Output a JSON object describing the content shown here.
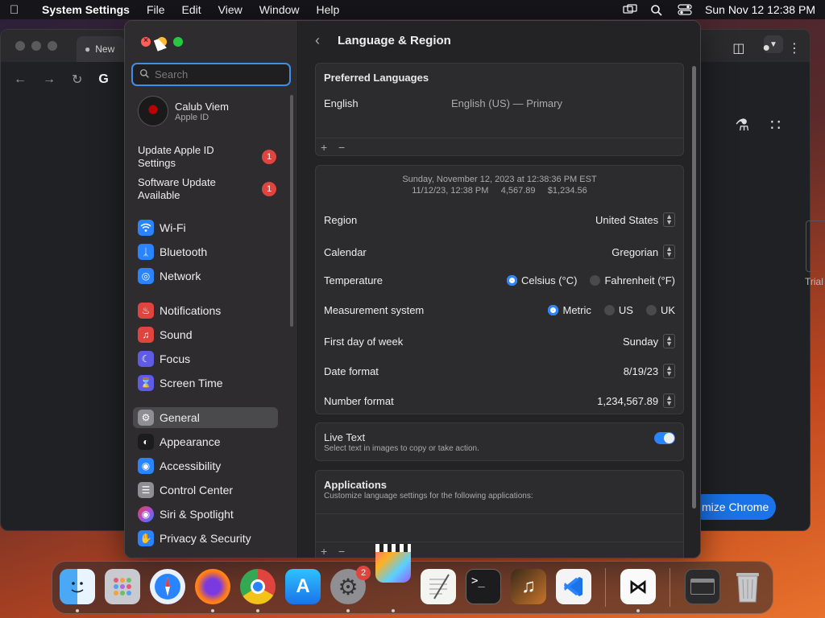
{
  "menubar": {
    "app_name": "System Settings",
    "menus": [
      "File",
      "Edit",
      "View",
      "Window",
      "Help"
    ],
    "datetime": "Sun Nov 12  12:38 PM"
  },
  "chrome": {
    "tab_label": "New",
    "customize_label": "mize Chrome",
    "trial_text": "Trial"
  },
  "sidebar": {
    "search_placeholder": "Search",
    "profile": {
      "name": "Calub Viem",
      "sub": "Apple ID"
    },
    "notices": [
      {
        "label": "Update Apple ID Settings",
        "badge": "1"
      },
      {
        "label": "Software Update Available",
        "badge": "1"
      }
    ],
    "items": [
      {
        "label": "Wi-Fi",
        "icon": "wifi-icon",
        "color": "#2a84ff"
      },
      {
        "label": "Bluetooth",
        "icon": "bluetooth-icon",
        "color": "#2a84ff"
      },
      {
        "label": "Network",
        "icon": "globe-icon",
        "color": "#2a84ff"
      },
      {
        "label": "Notifications",
        "icon": "bell-icon",
        "color": "#e0443e"
      },
      {
        "label": "Sound",
        "icon": "speaker-icon",
        "color": "#e0443e"
      },
      {
        "label": "Focus",
        "icon": "moon-icon",
        "color": "#5e5ce6"
      },
      {
        "label": "Screen Time",
        "icon": "hourglass-icon",
        "color": "#5e5ce6"
      },
      {
        "label": "General",
        "icon": "gear-icon",
        "color": "#8e8e93"
      },
      {
        "label": "Appearance",
        "icon": "appearance-icon",
        "color": "#1c1c1e"
      },
      {
        "label": "Accessibility",
        "icon": "accessibility-icon",
        "color": "#2a84ff"
      },
      {
        "label": "Control Center",
        "icon": "control-center-icon",
        "color": "#8e8e93"
      },
      {
        "label": "Siri & Spotlight",
        "icon": "siri-icon",
        "color": "#b04ad6"
      },
      {
        "label": "Privacy & Security",
        "icon": "hand-icon",
        "color": "#2a84ff"
      }
    ]
  },
  "content": {
    "title": "Language & Region",
    "preferred_languages": {
      "heading": "Preferred Languages",
      "language": "English",
      "detail": "English (US) — Primary"
    },
    "preview": {
      "line1": "Sunday, November 12, 2023 at 12:38:36 PM EST",
      "line2": "11/12/23, 12:38 PM     4,567.89     $1,234.56"
    },
    "settings": {
      "region": {
        "label": "Region",
        "value": "United States"
      },
      "calendar": {
        "label": "Calendar",
        "value": "Gregorian"
      },
      "temperature": {
        "label": "Temperature",
        "opt1": "Celsius (°C)",
        "opt2": "Fahrenheit (°F)"
      },
      "measurement": {
        "label": "Measurement system",
        "opt1": "Metric",
        "opt2": "US",
        "opt3": "UK"
      },
      "first_day": {
        "label": "First day of week",
        "value": "Sunday"
      },
      "date_format": {
        "label": "Date format",
        "value": "8/19/23"
      },
      "number_format": {
        "label": "Number format",
        "value": "1,234,567.89"
      }
    },
    "live_text": {
      "label": "Live Text",
      "sub": "Select text in images to copy or take action."
    },
    "applications": {
      "heading": "Applications",
      "sub": "Customize language settings for the following applications:"
    },
    "plus": "+",
    "minus": "−"
  },
  "dock": {
    "settings_badge": "2",
    "apps": [
      "finder-icon",
      "launchpad-icon",
      "safari-icon",
      "firefox-icon",
      "chrome-icon",
      "app-store-icon",
      "system-settings-icon",
      "final-cut-icon",
      "textedit-icon",
      "terminal-icon",
      "garageband-icon",
      "vscode-icon",
      "capcut-icon",
      "window-icon",
      "trash-icon"
    ]
  }
}
